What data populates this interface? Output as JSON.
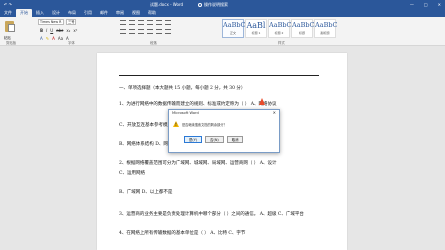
{
  "colors": {
    "accent": "#2b579a",
    "warning": "#e94b2a"
  },
  "titlebar": {
    "qat": "↶ ↷",
    "doc_title": "试题.docx - Word",
    "search": "操作说明搜索",
    "controls": [
      "—",
      "□",
      "✕"
    ]
  },
  "tabs": [
    "文件",
    "开始",
    "插入",
    "设计",
    "布局",
    "引用",
    "邮件",
    "审阅",
    "视图",
    "帮助"
  ],
  "ribbon": {
    "paste": "粘贴",
    "clipboard": "剪贴板",
    "font_name": "Times New R",
    "font_size": "三号",
    "font_group": "字体",
    "para_group": "段落",
    "styles_group": "样式",
    "fmt_row1": [
      "B",
      "I",
      "U",
      "abc",
      "x₂",
      "x²"
    ],
    "fmt_row2": [
      "A",
      "✎",
      "A",
      "Aa",
      "A"
    ],
    "styles": [
      {
        "sample": "AaBbC",
        "name": "正文"
      },
      {
        "sample": "AaBl",
        "name": "标题 1"
      },
      {
        "sample": "AaBbC",
        "name": "标题 2"
      },
      {
        "sample": "AaBbC",
        "name": "标题"
      },
      {
        "sample": "AaBbC",
        "name": "副标题"
      }
    ]
  },
  "document": {
    "lines": [
      "一、单项选择题（本大题共 15 小题，每小题 2 分，共 30 分）",
      "1、为进行网络中的数据传输而建立的规则、标准或约定称为（     ）    A、网络协议",
      "C、开放互连基本参考模型",
      "B、网络体系结构  D、网络体系",
      "2、根据网络覆盖范围可分为广域网、城域网、局域网、运营商网（     ）   A、设计",
      "C、运用网络",
      "B、广域网   D、以上都不是",
      "3、运营商的业务主要是负责处理计算机中哪个部分（     ）之间的通信。  A、超级  C、广域平台",
      "4、在网络上所有传输数据的基本单位是（     ）   A、比特  C、字节"
    ]
  },
  "dialog": {
    "title": "Microsoft Word",
    "close": "✕",
    "message": "是否继续搜索文档的剩余部分？",
    "buttons": [
      "是(Y)",
      "否(N)",
      "取消"
    ]
  }
}
